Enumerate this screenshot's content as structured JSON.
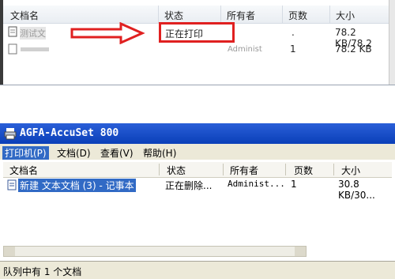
{
  "top_panel": {
    "columns": [
      "文档名",
      "状态",
      "所有者",
      "页数",
      "大小"
    ],
    "row1": {
      "name": "测试文",
      "status": "正在打印",
      "owner": ".",
      "size": "78.2 KB/78.2"
    },
    "row2": {
      "name": "",
      "owner": "Administ",
      "pages": "1",
      "size": "78.2 KB"
    }
  },
  "window": {
    "title": "AGFA-AccuSet 800",
    "menu": [
      {
        "label": "打印机(P)"
      },
      {
        "label": "文档(D)"
      },
      {
        "label": "查看(V)"
      },
      {
        "label": "帮助(H)"
      }
    ],
    "columns": [
      "文档名",
      "状态",
      "所有者",
      "页数",
      "大小"
    ],
    "row": {
      "name": "新建 文本文档 (3) - 记事本",
      "status": "正在删除...",
      "owner": "Administ...",
      "pages": "1",
      "size": "30.8 KB/30..."
    },
    "status_text": "队列中有 1 个文档"
  },
  "colors": {
    "title_bar": "#0a3fb8",
    "menu_highlight": "#316ac5",
    "annotation": "#e02020"
  }
}
